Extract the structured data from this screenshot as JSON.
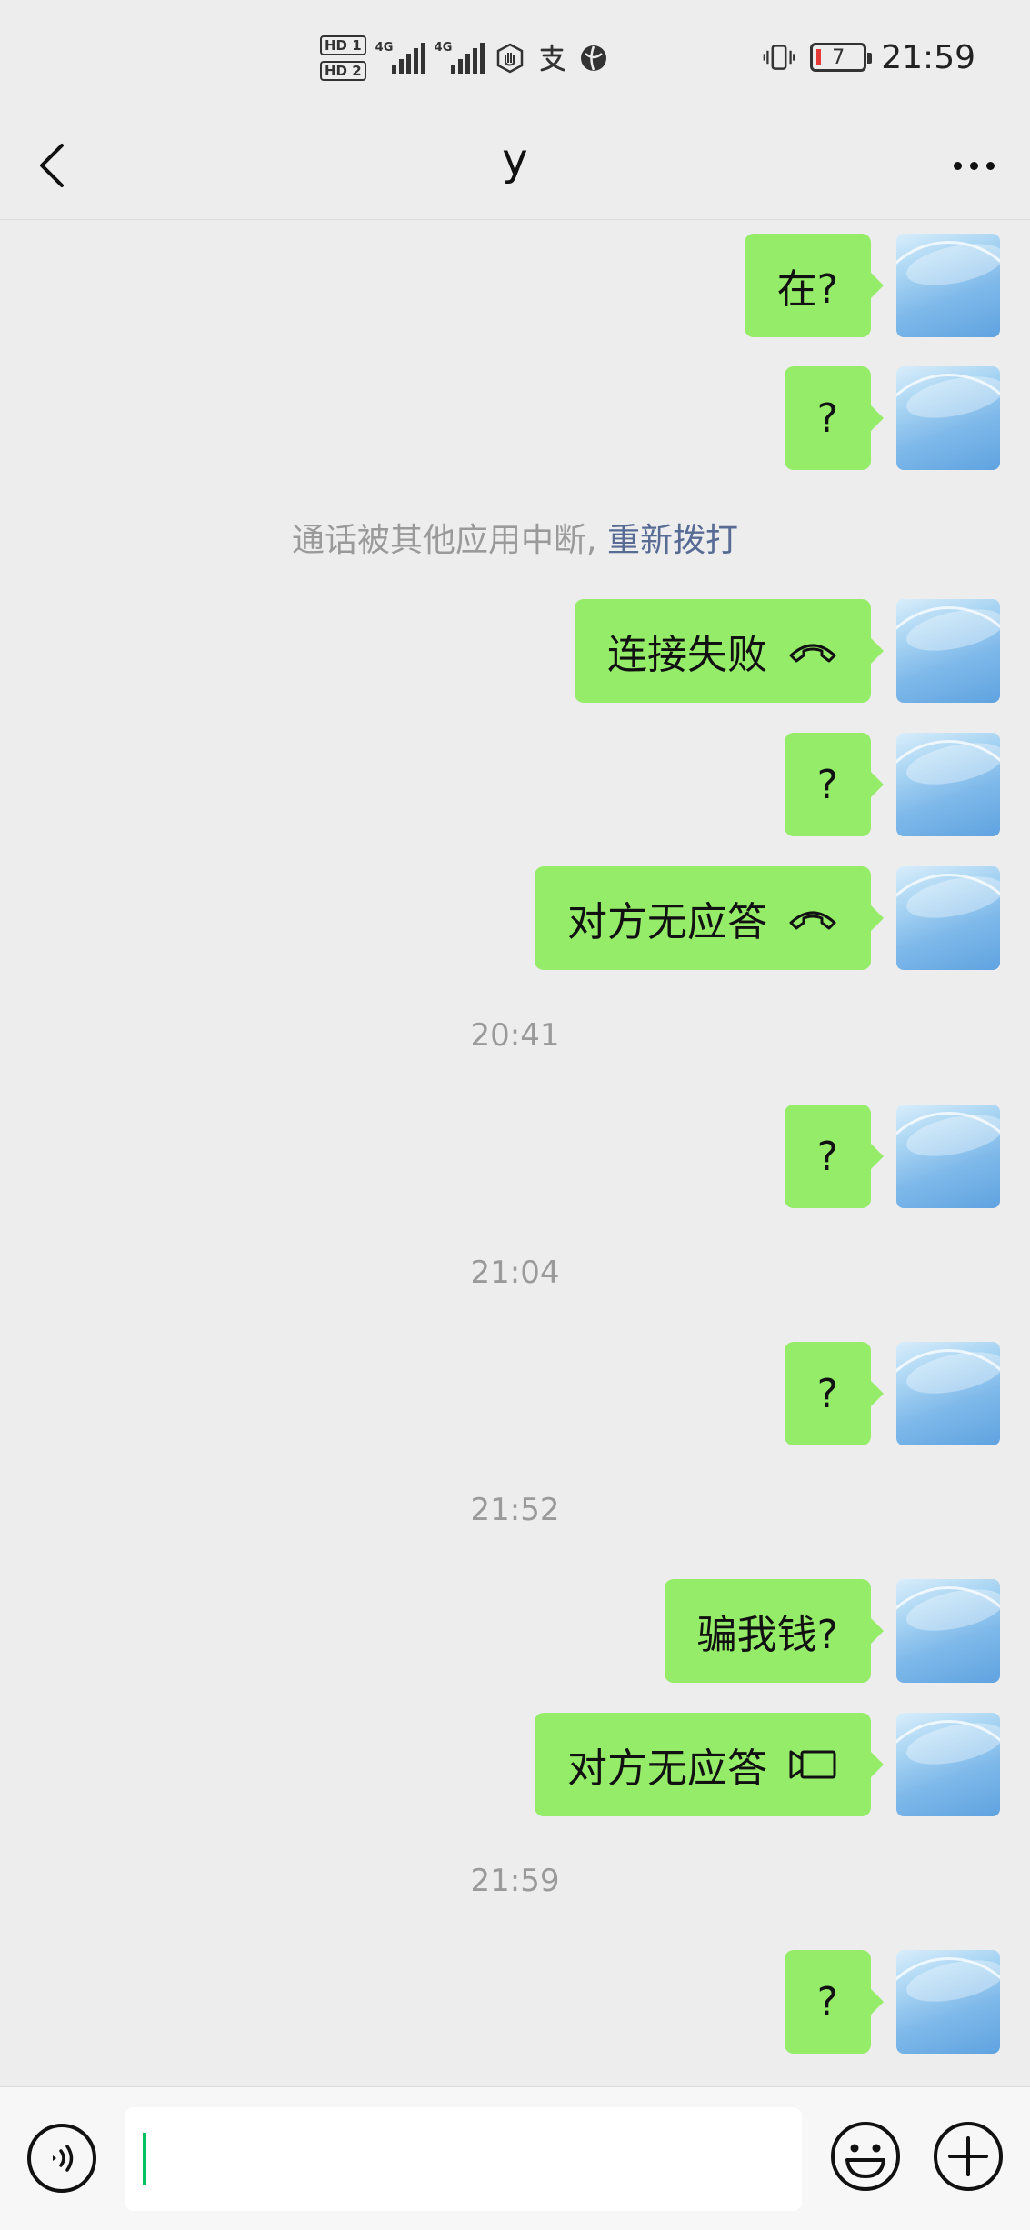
{
  "status_bar": {
    "hd1": "HD 1",
    "hd2": "HD 2",
    "net1": "4G",
    "net2": "4G",
    "battery_level": "7",
    "time": "21:59",
    "icons": [
      "hd-icon",
      "signal-icon",
      "signal-icon",
      "hand-icon",
      "alipay-icon",
      "browser-icon",
      "vibrate-icon",
      "battery-icon"
    ]
  },
  "header": {
    "title": "y",
    "back_icon": "chevron-left-icon",
    "more_icon": "more-dots-icon"
  },
  "messages": [
    {
      "type": "sent",
      "text": "在?"
    },
    {
      "type": "sent",
      "text": "?"
    },
    {
      "type": "system",
      "text": "通话被其他应用中断,",
      "link": "重新拨打"
    },
    {
      "type": "sent",
      "text": "连接失败",
      "icon": "phone-hangup-icon"
    },
    {
      "type": "sent",
      "text": "?"
    },
    {
      "type": "sent",
      "text": "对方无应答",
      "icon": "phone-hangup-icon"
    },
    {
      "type": "time",
      "text": "20:41"
    },
    {
      "type": "sent",
      "text": "?"
    },
    {
      "type": "time",
      "text": "21:04"
    },
    {
      "type": "sent",
      "text": "?"
    },
    {
      "type": "time",
      "text": "21:52"
    },
    {
      "type": "sent",
      "text": "骗我钱?"
    },
    {
      "type": "sent",
      "text": "对方无应答",
      "icon": "video-call-icon"
    },
    {
      "type": "time",
      "text": "21:59"
    },
    {
      "type": "sent",
      "text": "?"
    }
  ],
  "input_bar": {
    "value": "",
    "voice_icon": "voice-icon",
    "emoji_icon": "emoji-icon",
    "plus_icon": "plus-icon"
  },
  "colors": {
    "bubble": "#95ec69",
    "background": "#ededed",
    "link": "#576b95",
    "caret": "#07c160"
  }
}
